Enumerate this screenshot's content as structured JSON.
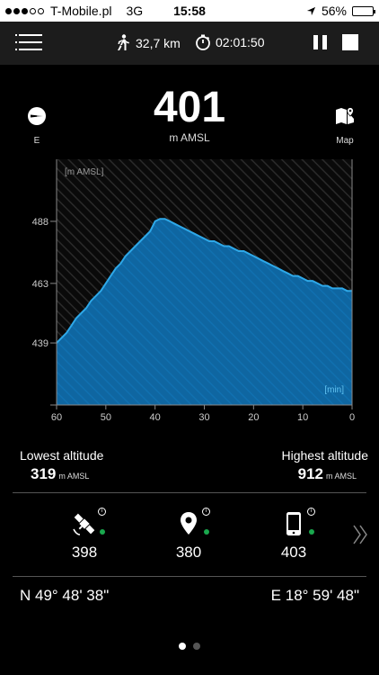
{
  "status_bar": {
    "carrier": "T-Mobile.pl",
    "network": "3G",
    "time": "15:58",
    "battery": "56%",
    "battery_level": 0.56,
    "signal_dots_filled": 3,
    "signal_dots_total": 5
  },
  "toolbar": {
    "distance": "32,7 km",
    "duration": "02:01:50"
  },
  "compass": {
    "label": "E",
    "icon": "compass-icon"
  },
  "map_button": {
    "label": "Map",
    "icon": "map-pin-icon"
  },
  "altitude": {
    "value": "401",
    "unit": "m AMSL"
  },
  "chart_data": {
    "type": "area",
    "ylabel": "[m AMSL]",
    "xlabel": "[min]",
    "y_ticks": [
      "488",
      "463",
      "439"
    ],
    "x_ticks": [
      "60",
      "50",
      "40",
      "30",
      "20",
      "10",
      "0"
    ],
    "x": [
      60,
      59,
      58,
      57,
      56,
      55,
      54,
      53,
      52,
      51,
      50,
      49,
      48,
      47,
      46,
      45,
      44,
      43,
      42,
      41,
      40,
      39,
      38,
      37,
      36,
      35,
      34,
      33,
      32,
      31,
      30,
      29,
      28,
      27,
      26,
      25,
      24,
      23,
      22,
      21,
      20,
      19,
      18,
      17,
      16,
      15,
      14,
      13,
      12,
      11,
      10,
      9,
      8,
      7,
      6,
      5,
      4,
      3,
      2,
      1,
      0
    ],
    "values": [
      439,
      441,
      443,
      446,
      449,
      451,
      453,
      456,
      458,
      460,
      463,
      466,
      469,
      471,
      474,
      476,
      478,
      480,
      482,
      484,
      488,
      489,
      489,
      488,
      487,
      486,
      485,
      484,
      483,
      482,
      481,
      480,
      480,
      479,
      478,
      478,
      477,
      476,
      476,
      475,
      474,
      473,
      472,
      471,
      470,
      469,
      468,
      467,
      466,
      466,
      465,
      464,
      464,
      463,
      462,
      462,
      461,
      461,
      461,
      460,
      460
    ],
    "xlim": [
      60,
      0
    ],
    "ylim": [
      414,
      513
    ],
    "fill_color": "#0f66a1",
    "line_color": "#2ea8e8"
  },
  "altitude_stats": {
    "lowest_title": "Lowest altitude",
    "lowest_value": "319",
    "lowest_unit": "m AMSL",
    "highest_title": "Highest altitude",
    "highest_value": "912",
    "highest_unit": "m AMSL"
  },
  "sources": [
    {
      "icon": "satellite-icon",
      "value": "398",
      "status_color": "#1aa84e"
    },
    {
      "icon": "location-pin-icon",
      "value": "380",
      "status_color": "#1aa84e"
    },
    {
      "icon": "phone-icon",
      "value": "403",
      "status_color": "#1aa84e"
    }
  ],
  "coordinates": {
    "latitude": "N 49° 48' 38\"",
    "longitude": "E 18° 59' 48\""
  },
  "pager": {
    "current": 1,
    "total": 2
  }
}
